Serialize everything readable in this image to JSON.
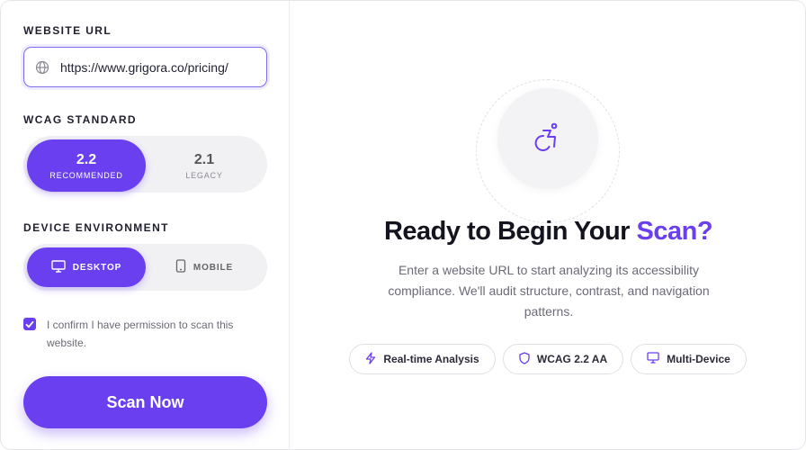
{
  "form": {
    "url_label": "WEBSITE URL",
    "url_value": "https://www.grigora.co/pricing/",
    "wcag_label": "WCAG STANDARD",
    "wcag_options": [
      {
        "version": "2.2",
        "tag": "RECOMMENDED",
        "selected": true
      },
      {
        "version": "2.1",
        "tag": "LEGACY",
        "selected": false
      }
    ],
    "device_label": "DEVICE ENVIRONMENT",
    "device_options": [
      {
        "label": "DESKTOP",
        "icon": "desktop-icon",
        "selected": true
      },
      {
        "label": "MOBILE",
        "icon": "mobile-icon",
        "selected": false
      }
    ],
    "confirm_checked": true,
    "confirm_text": "I confirm I have permission to scan this website.",
    "scan_button": "Scan Now"
  },
  "hero": {
    "icon": "accessibility-icon",
    "title_main": "Ready to Begin Your ",
    "title_accent": "Scan?",
    "description": "Enter a website URL to start analyzing its accessibility compliance. We'll audit structure, contrast, and navigation patterns.",
    "chips": [
      {
        "label": "Real-time Analysis",
        "icon": "lightning-icon"
      },
      {
        "label": "WCAG 2.2 AA",
        "icon": "shield-icon"
      },
      {
        "label": "Multi-Device",
        "icon": "monitor-icon"
      }
    ]
  },
  "colors": {
    "accent": "#6a3ff0",
    "text": "#14141f",
    "muted": "#6b6b78"
  }
}
